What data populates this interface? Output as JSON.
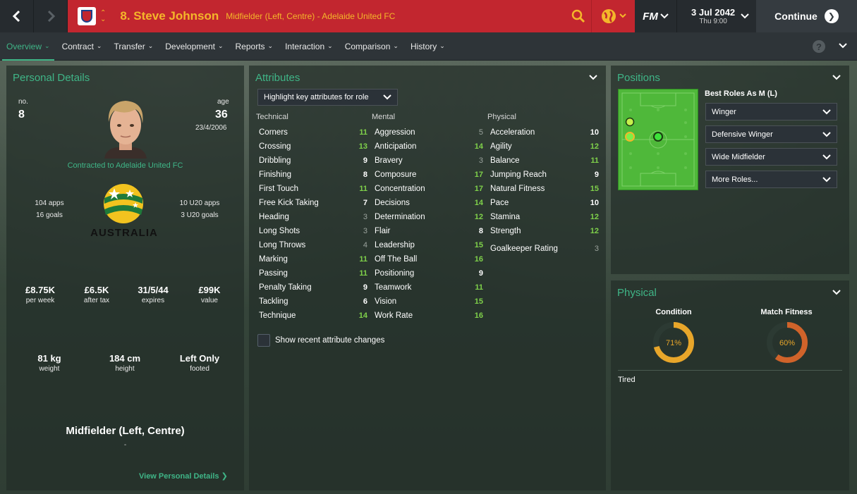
{
  "topbar": {
    "player_title": "8. Steve Johnson",
    "player_subtitle": "Midfielder (Left, Centre) - Adelaide United FC",
    "fm_logo": "FM",
    "date": "3 Jul 2042",
    "time": "Thu 9:00",
    "continue_label": "Continue"
  },
  "tabs": [
    {
      "label": "Overview"
    },
    {
      "label": "Contract"
    },
    {
      "label": "Transfer"
    },
    {
      "label": "Development"
    },
    {
      "label": "Reports"
    },
    {
      "label": "Interaction"
    },
    {
      "label": "Comparison"
    },
    {
      "label": "History"
    }
  ],
  "help_label": "?",
  "personal": {
    "title": "Personal Details",
    "no_label": "no.",
    "no_value": "8",
    "age_label": "age",
    "age_value": "36",
    "dob": "23/4/2006",
    "contract": "Contracted to Adelaide United FC",
    "apps": "104 apps",
    "goals": "16 goals",
    "u20_apps": "10 U20 apps",
    "u20_goals": "3 U20 goals",
    "country": "AUSTRALIA",
    "wage": "£8.75K",
    "wage_label": "per week",
    "after_tax": "£6.5K",
    "after_tax_label": "after tax",
    "expires": "31/5/44",
    "expires_label": "expires",
    "value": "£99K",
    "value_label": "value",
    "weight": "81 kg",
    "weight_label": "weight",
    "height": "184 cm",
    "height_label": "height",
    "foot": "Left Only",
    "foot_label": "footed",
    "position": "Midfielder (Left, Centre)",
    "position_sub": "-",
    "view_link": "View Personal Details"
  },
  "attributes": {
    "title": "Attributes",
    "highlight": "Highlight key attributes for role",
    "technical_header": "Technical",
    "mental_header": "Mental",
    "physical_header": "Physical",
    "technical": [
      {
        "name": "Corners",
        "value": "11",
        "color": "green"
      },
      {
        "name": "Crossing",
        "value": "13",
        "color": "green"
      },
      {
        "name": "Dribbling",
        "value": "9",
        "color": "white"
      },
      {
        "name": "Finishing",
        "value": "8",
        "color": "white"
      },
      {
        "name": "First Touch",
        "value": "11",
        "color": "green"
      },
      {
        "name": "Free Kick Taking",
        "value": "7",
        "color": "white"
      },
      {
        "name": "Heading",
        "value": "3",
        "color": "grey"
      },
      {
        "name": "Long Shots",
        "value": "3",
        "color": "grey"
      },
      {
        "name": "Long Throws",
        "value": "4",
        "color": "grey"
      },
      {
        "name": "Marking",
        "value": "11",
        "color": "green"
      },
      {
        "name": "Passing",
        "value": "11",
        "color": "green"
      },
      {
        "name": "Penalty Taking",
        "value": "9",
        "color": "white"
      },
      {
        "name": "Tackling",
        "value": "6",
        "color": "white"
      },
      {
        "name": "Technique",
        "value": "14",
        "color": "green"
      }
    ],
    "mental": [
      {
        "name": "Aggression",
        "value": "5",
        "color": "grey"
      },
      {
        "name": "Anticipation",
        "value": "14",
        "color": "green"
      },
      {
        "name": "Bravery",
        "value": "3",
        "color": "grey"
      },
      {
        "name": "Composure",
        "value": "17",
        "color": "green"
      },
      {
        "name": "Concentration",
        "value": "17",
        "color": "green"
      },
      {
        "name": "Decisions",
        "value": "14",
        "color": "green"
      },
      {
        "name": "Determination",
        "value": "12",
        "color": "green"
      },
      {
        "name": "Flair",
        "value": "8",
        "color": "white"
      },
      {
        "name": "Leadership",
        "value": "15",
        "color": "green"
      },
      {
        "name": "Off The Ball",
        "value": "16",
        "color": "green"
      },
      {
        "name": "Positioning",
        "value": "9",
        "color": "white"
      },
      {
        "name": "Teamwork",
        "value": "11",
        "color": "green"
      },
      {
        "name": "Vision",
        "value": "15",
        "color": "green"
      },
      {
        "name": "Work Rate",
        "value": "16",
        "color": "green"
      }
    ],
    "physical": [
      {
        "name": "Acceleration",
        "value": "10",
        "color": "white"
      },
      {
        "name": "Agility",
        "value": "12",
        "color": "green"
      },
      {
        "name": "Balance",
        "value": "11",
        "color": "green"
      },
      {
        "name": "Jumping Reach",
        "value": "9",
        "color": "white"
      },
      {
        "name": "Natural Fitness",
        "value": "15",
        "color": "green"
      },
      {
        "name": "Pace",
        "value": "10",
        "color": "white"
      },
      {
        "name": "Stamina",
        "value": "12",
        "color": "green"
      },
      {
        "name": "Strength",
        "value": "12",
        "color": "green"
      }
    ],
    "goalkeeper_label": "Goalkeeper Rating",
    "goalkeeper_value": "3",
    "recent_changes": "Show recent attribute changes"
  },
  "positions": {
    "title": "Positions",
    "best_roles": "Best Roles As M (L)",
    "roles": [
      "Winger",
      "Defensive Winger",
      "Wide Midfielder",
      "More Roles..."
    ]
  },
  "physical": {
    "title": "Physical",
    "condition_label": "Condition",
    "condition_value": 71,
    "condition_text": "71%",
    "fitness_label": "Match Fitness",
    "fitness_value": 60,
    "fitness_text": "60%",
    "status": "Tired"
  },
  "colors": {
    "accent_green": "#3fb587",
    "title_red": "#c2262f",
    "title_yellow": "#f4b62a",
    "condition_orange": "#e8a62a",
    "fitness_orange": "#d0632a"
  }
}
